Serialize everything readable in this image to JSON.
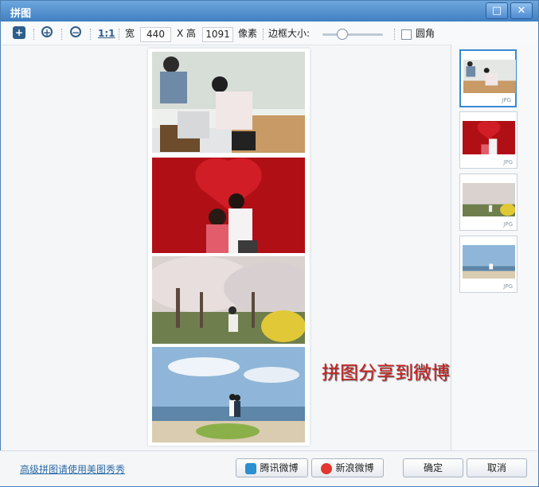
{
  "window": {
    "title": "拼图",
    "maximize_glyph": "□",
    "close_glyph": "✕"
  },
  "toolbar": {
    "add_glyph": "+",
    "zoom_in_glyph": "+",
    "zoom_out_glyph": "−",
    "actual_size_label": "1:1",
    "width_label": "宽",
    "width_value": "440",
    "height_prefix": "X 高",
    "height_value": "1091",
    "unit_label": "像素",
    "border_label": "边框大小:",
    "border_slider": 0.35,
    "rounded_label": "圆角",
    "rounded_checked": false
  },
  "overlay": {
    "text": "拼图分享到微博"
  },
  "thumbnails": [
    {
      "tag": "JPG"
    },
    {
      "tag": "JPG"
    },
    {
      "tag": "JPG"
    },
    {
      "tag": "JPG"
    }
  ],
  "footer": {
    "link_text": "高级拼图请使用美图秀秀",
    "tencent_label": "腾讯微博",
    "sina_label": "新浪微博",
    "ok_label": "确定",
    "cancel_label": "取消"
  }
}
